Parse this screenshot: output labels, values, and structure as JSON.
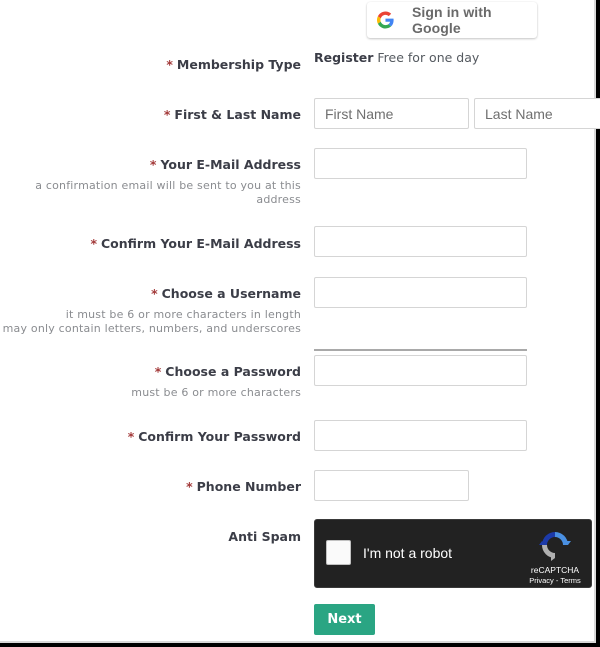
{
  "google_signin": {
    "label": "Sign in with Google",
    "icon": "google-g-icon"
  },
  "membership": {
    "label": "Membership Type",
    "required_mark": "*",
    "value_bold": "Register",
    "value_text": "Free for one day"
  },
  "fields": {
    "name": {
      "label": "First & Last Name",
      "required_mark": "*",
      "first_placeholder": "First Name",
      "first_value": "",
      "last_placeholder": "Last Name",
      "last_value": ""
    },
    "email": {
      "label": "Your E-Mail Address",
      "required_mark": "*",
      "hint_line1": "a confirmation email will be sent to you at this",
      "hint_line2": "address",
      "value": ""
    },
    "confirm_email": {
      "label": "Confirm Your E-Mail Address",
      "required_mark": "*",
      "value": ""
    },
    "username": {
      "label": "Choose a Username",
      "required_mark": "*",
      "hint_line1": "it must be 6 or more characters in length",
      "hint_line2": "may only contain letters, numbers, and underscores",
      "value": ""
    },
    "password": {
      "label": "Choose a Password",
      "required_mark": "*",
      "hint": "must be 6 or more characters",
      "value": ""
    },
    "confirm_password": {
      "label": "Confirm Your Password",
      "required_mark": "*",
      "value": ""
    },
    "phone": {
      "label": "Phone Number",
      "required_mark": "*",
      "value": ""
    }
  },
  "anti_spam": {
    "label": "Anti Spam",
    "checkbox_label": "I'm not a robot",
    "checked": false,
    "brand": "reCAPTCHA",
    "privacy_link": "Privacy",
    "separator": " - ",
    "terms_link": "Terms"
  },
  "next_button": {
    "label": "Next"
  },
  "colors": {
    "required": "#a33a3a",
    "primary_button": "#2aa583",
    "captcha_bg": "#222222",
    "label_text": "#3b3d47"
  }
}
